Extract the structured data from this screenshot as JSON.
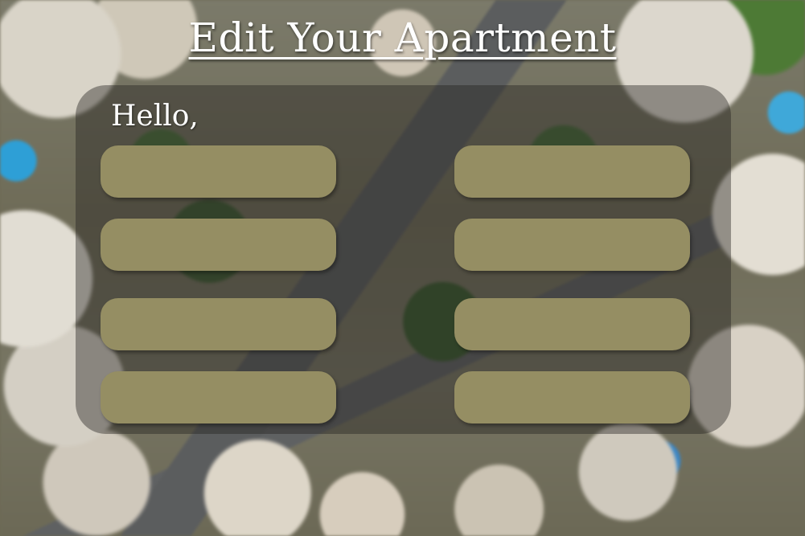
{
  "header": {
    "title": "Edit Your Apartment"
  },
  "form": {
    "greeting": "Hello,",
    "fields": [
      {
        "value": "",
        "placeholder": ""
      },
      {
        "value": "",
        "placeholder": ""
      },
      {
        "value": "",
        "placeholder": ""
      },
      {
        "value": "",
        "placeholder": ""
      },
      {
        "value": "",
        "placeholder": ""
      },
      {
        "value": "",
        "placeholder": ""
      },
      {
        "value": "",
        "placeholder": ""
      },
      {
        "value": "",
        "placeholder": ""
      }
    ],
    "field_color": "#958e63"
  },
  "colors": {
    "title_text": "#ffffff",
    "panel_overlay": "#23211e"
  },
  "background": {
    "description_icon": "aerial-neighborhood-image"
  }
}
